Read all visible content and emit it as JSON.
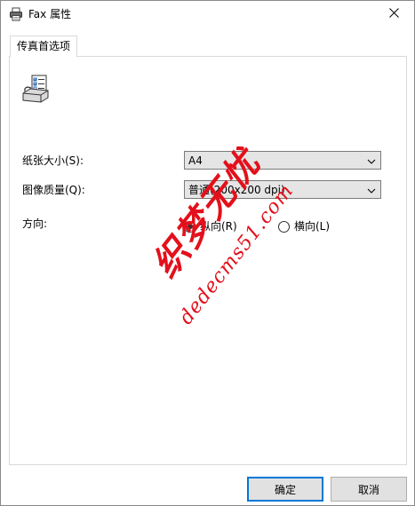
{
  "window": {
    "title": "Fax 属性",
    "close_label": "✕"
  },
  "tabs": [
    {
      "label": "传真首选项",
      "selected": true
    }
  ],
  "fields": {
    "paper_size": {
      "label": "纸张大小(S):",
      "value": "A4"
    },
    "image_quality": {
      "label": "图像质量(Q):",
      "value": "普通(200x200 dpi)"
    },
    "orientation": {
      "label": "方向:",
      "options": [
        {
          "label": "纵向(R)",
          "checked": true
        },
        {
          "label": "横向(L)",
          "checked": false
        }
      ]
    }
  },
  "watermark": {
    "line1": "织梦无忧",
    "line2": "dedecms51.com",
    "color": "#e3101b"
  },
  "buttons": {
    "ok": "确定",
    "cancel": "取消"
  },
  "colors": {
    "accent": "#0078d7",
    "button_bg": "#e1e1e1",
    "select_bg": "#e5e5e5"
  }
}
